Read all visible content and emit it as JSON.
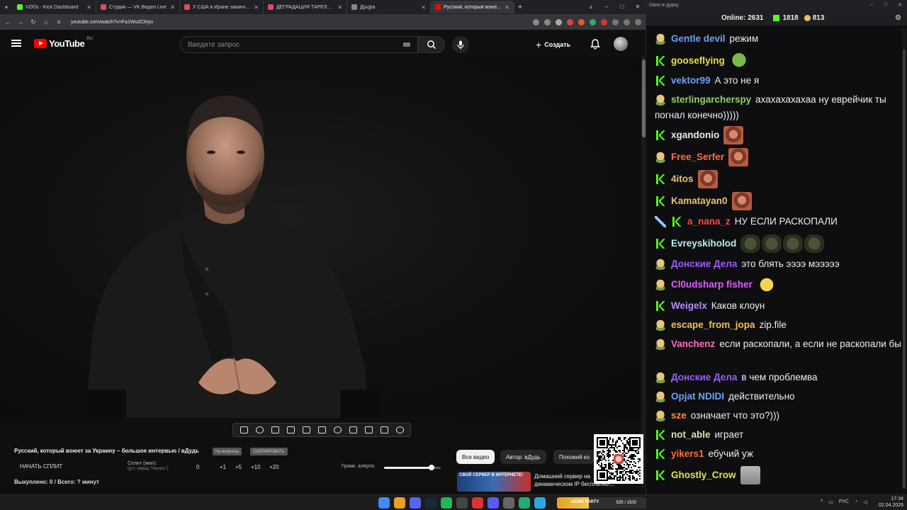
{
  "browser": {
    "tabs": [
      {
        "title": "VODs - Kick Dashboard",
        "color": "#53fc18",
        "active": false
      },
      {
        "title": "Студия — VK Видео Live",
        "color": "#e04a5f",
        "active": false
      },
      {
        "title": "У США в Иране заканчиваются",
        "color": "#e04a5f",
        "active": false
      },
      {
        "title": "ДЕГРАДАЦИЯ ТАРЕЛОЧНИЦ",
        "color": "#e04a5f",
        "active": false
      },
      {
        "title": "Д[ы]ра",
        "color": "#888888",
        "active": false
      },
      {
        "title": "Русский, который воюет з",
        "color": "#ff0000",
        "active": true
      }
    ],
    "url": "youtube.com/watch?v=Fa1Wu0Cktyo"
  },
  "youtube": {
    "logo_text": "YouTube",
    "region": "RU",
    "search_placeholder": "Введите запрос",
    "create_label": "Создать"
  },
  "below_video": {
    "title": "Русский, который воюет за Украину – большое интервью / вДудь",
    "chip_1": "На вопросы",
    "chip_2": "СКОПИРОВАТЬ",
    "start_split": "НАЧАТЬ СПЛИТ",
    "split_label": "Сплит (мин):",
    "split_hint": "(уст. перед \"Начать\")",
    "split_values": [
      "0",
      "+1",
      "+5",
      "+10",
      "+20"
    ],
    "bought": "Выкуплено: 0 / Всего: ? минут",
    "volume_label": "Громк. алерта:",
    "volume_level": 0.84,
    "filters": [
      "Все видео",
      "Автор: вДудь",
      "Похожий ко"
    ],
    "rec_thumb_text": "СВОЙ СЕРВЕР В ИНТЕРНЕТЕ!",
    "rec_title": "Домашний сервер на динамическом IP бесплатно!..."
  },
  "chat": {
    "window_title": "Окно в дурку",
    "online_label": "Online:",
    "online_count": "2631",
    "kick_count": "1818",
    "youtube_count": "813",
    "messages": [
      {
        "badge": "frog",
        "user": "Gentle devil",
        "color": "#6aa2f7",
        "text": "режим",
        "emotes": []
      },
      {
        "badge": "kick",
        "user": "gooseflying",
        "color": "#dfe34a",
        "text": "",
        "emotes": [
          "pepe"
        ]
      },
      {
        "badge": "kick",
        "user": "vektor99",
        "color": "#6aa2f7",
        "text": "А это не я",
        "emotes": []
      },
      {
        "badge": "frog",
        "user": "sterlingarchersру",
        "color": "#8fd16a",
        "text": "ахахахахахаа ну еврейчик ты погнал конечно)))))",
        "emotes": []
      },
      {
        "badge": "kick",
        "user": "xgandonio",
        "color": "#eaeaea",
        "text": "",
        "emotes": [
          "face"
        ]
      },
      {
        "badge": "frog",
        "user": "Free_Serfer",
        "color": "#ff6b3d",
        "text": "",
        "emotes": [
          "face"
        ]
      },
      {
        "badge": "kick",
        "user": "4itos",
        "color": "#e8c26a",
        "text": "",
        "emotes": [
          "face"
        ]
      },
      {
        "badge": "kick",
        "user": "Kamatayan0",
        "color": "#e8c26a",
        "text": "",
        "emotes": [
          "face"
        ]
      },
      {
        "badge": "sword",
        "user": "a_nana_z",
        "color": "#ff4444",
        "text": "НУ ЕСЛИ РАСКОПАЛИ",
        "emotes": []
      },
      {
        "badge": "kick",
        "user": "Evreyskiholod",
        "color": "#b6f0f0",
        "text": "",
        "emotes": [
          "seal",
          "seal",
          "seal",
          "seal"
        ]
      },
      {
        "badge": "frog",
        "user": "Донские Дела",
        "color": "#9b5cff",
        "text": "это блять ээээ мэээээ",
        "emotes": []
      },
      {
        "badge": "frog",
        "user": "Cl0udsharp fisher",
        "color": "#e25cff",
        "text": "",
        "emotes": [
          "laugh"
        ]
      },
      {
        "badge": "kick",
        "user": "Weigelx",
        "color": "#b98cff",
        "text": "Каков клоун",
        "emotes": []
      },
      {
        "badge": "frog",
        "user": "escape_from_jopa",
        "color": "#f2c14e",
        "text": "zip.file",
        "emotes": []
      },
      {
        "badge": "frog",
        "user": "Vanchenz",
        "color": "#ff6fbf",
        "text": "если раскопали, а если не раскопали бы",
        "emotes": []
      },
      {
        "badge": "frog",
        "user": "Донские Дела",
        "color": "#9b5cff",
        "text": "в чем проблемва",
        "emotes": []
      },
      {
        "badge": "frog",
        "user": "Opjat NDIDI",
        "color": "#6aa2f7",
        "text": "действительно",
        "emotes": []
      },
      {
        "badge": "frog",
        "user": "sze",
        "color": "#ff8c42",
        "text": "означает что это?)))",
        "emotes": []
      },
      {
        "badge": "kick",
        "user": "not_able",
        "color": "#cfe8a8",
        "text": "играет",
        "emotes": []
      },
      {
        "badge": "kick",
        "user": "yikers1",
        "color": "#ff6b3d",
        "text": "ебучий уж",
        "emotes": []
      },
      {
        "badge": "kick",
        "user": "Ghostly_Crow",
        "color": "#dfe34a",
        "text": "",
        "emotes": [
          "cat"
        ]
      }
    ]
  },
  "taskbar": {
    "progress_label": "MEME PARTY",
    "progress_count": "535 / 1500",
    "progress_level": 0.357,
    "lang": "РУС",
    "time": "17:34",
    "date": "02.04.2026"
  }
}
